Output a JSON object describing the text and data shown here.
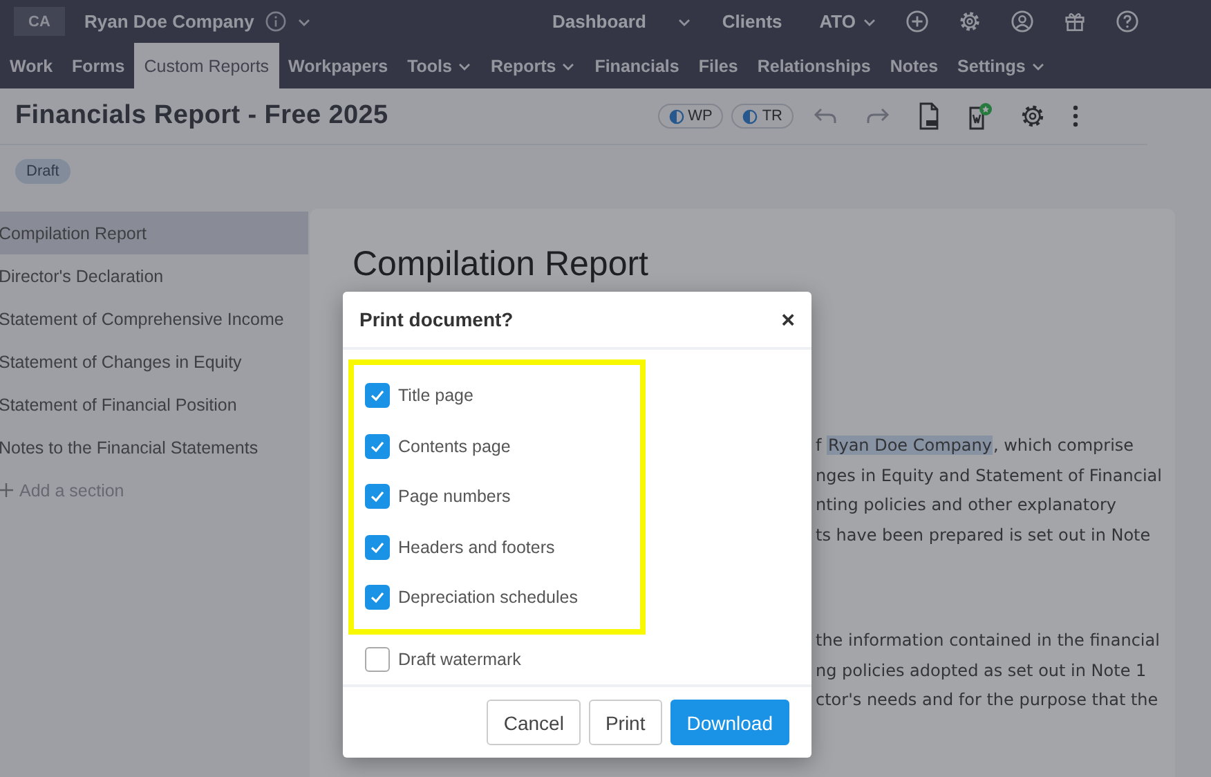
{
  "topbar": {
    "initials": "CA",
    "company": "Ryan Doe Company",
    "links": [
      {
        "label": "Dashboard",
        "caret": true
      },
      {
        "label": "Clients",
        "caret": false
      },
      {
        "label": "ATO",
        "caret": true
      }
    ]
  },
  "nav": [
    {
      "label": "Work",
      "selected": false,
      "caret": false
    },
    {
      "label": "Forms",
      "selected": false,
      "caret": false
    },
    {
      "label": "Custom Reports",
      "selected": true,
      "caret": false
    },
    {
      "label": "Workpapers",
      "selected": false,
      "caret": false
    },
    {
      "label": "Tools",
      "selected": false,
      "caret": true
    },
    {
      "label": "Reports",
      "selected": false,
      "caret": true
    },
    {
      "label": "Financials",
      "selected": false,
      "caret": false
    },
    {
      "label": "Files",
      "selected": false,
      "caret": false
    },
    {
      "label": "Relationships",
      "selected": false,
      "caret": false
    },
    {
      "label": "Notes",
      "selected": false,
      "caret": false
    },
    {
      "label": "Settings",
      "selected": false,
      "caret": true
    }
  ],
  "header": {
    "title": "Financials Report - Free 2025",
    "pills": [
      "WP",
      "TR"
    ],
    "status": "Draft"
  },
  "sidebar": {
    "items": [
      {
        "label": "Compilation Report",
        "selected": true
      },
      {
        "label": "Director's Declaration",
        "selected": false
      },
      {
        "label": "Statement of Comprehensive Income",
        "selected": false
      },
      {
        "label": "Statement of Changes in Equity",
        "selected": false
      },
      {
        "label": "Statement of Financial Position",
        "selected": false
      },
      {
        "label": "Notes to the Financial Statements",
        "selected": false
      }
    ],
    "add": "Add a section"
  },
  "document": {
    "heading": "Compilation Report",
    "paragraph_1": [
      "f **Ryan Doe Company**, which comprise",
      "nges in Equity and Statement of Financial",
      "nting policies and other explanatory",
      "ts have been prepared is set out in Note"
    ],
    "paragraph_2": [
      "the information contained in the financial",
      "ng policies adopted as set out in Note 1",
      "ctor's needs and for the purpose that the"
    ]
  },
  "dialog": {
    "title": "Print document?",
    "close": "×",
    "options": [
      {
        "label": "Title page",
        "checked": true,
        "highlighted": true
      },
      {
        "label": "Contents page",
        "checked": true,
        "highlighted": true
      },
      {
        "label": "Page numbers",
        "checked": true,
        "highlighted": true
      },
      {
        "label": "Headers and footers",
        "checked": true,
        "highlighted": true
      },
      {
        "label": "Depreciation schedules",
        "checked": true,
        "highlighted": true
      },
      {
        "label": "Draft watermark",
        "checked": false,
        "highlighted": false
      }
    ],
    "buttons": [
      {
        "label": "Cancel",
        "kind": "secondary"
      },
      {
        "label": "Print",
        "kind": "secondary"
      },
      {
        "label": "Download",
        "kind": "primary"
      }
    ]
  }
}
